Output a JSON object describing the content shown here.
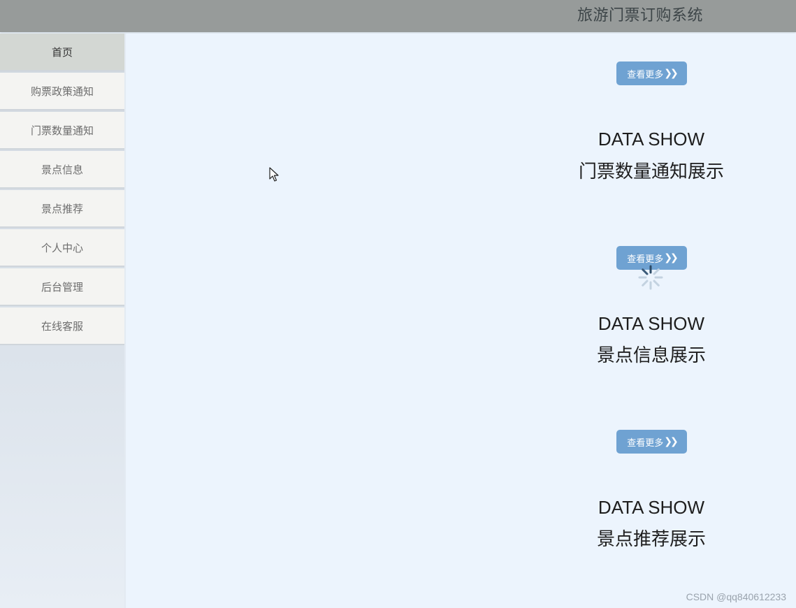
{
  "header": {
    "title": "旅游门票订购系统"
  },
  "sidebar": {
    "items": [
      {
        "label": "首页",
        "active": true
      },
      {
        "label": "购票政策通知",
        "active": false
      },
      {
        "label": "门票数量通知",
        "active": false
      },
      {
        "label": "景点信息",
        "active": false
      },
      {
        "label": "景点推荐",
        "active": false
      },
      {
        "label": "个人中心",
        "active": false
      },
      {
        "label": "后台管理",
        "active": false
      },
      {
        "label": "在线客服",
        "active": false
      }
    ]
  },
  "main": {
    "sections": [
      {
        "button_label": "查看更多",
        "button_icon": "double-chevron-right-icon",
        "title_en": "DATA SHOW",
        "title_cn": "门票数量通知展示"
      },
      {
        "button_label": "查看更多",
        "button_icon": "double-chevron-right-icon",
        "title_en": "DATA SHOW",
        "title_cn": "景点信息展示"
      },
      {
        "button_label": "查看更多",
        "button_icon": "double-chevron-right-icon",
        "title_en": "DATA SHOW",
        "title_cn": "景点推荐展示"
      }
    ]
  },
  "watermark": "CSDN @qq840612233",
  "colors": {
    "header_bg": "#979b9a",
    "content_bg": "#ecf4fd",
    "button_bg": "#6fa2d2",
    "nav_active_bg": "#d3d7d3",
    "nav_bg": "#f4f4f2"
  }
}
